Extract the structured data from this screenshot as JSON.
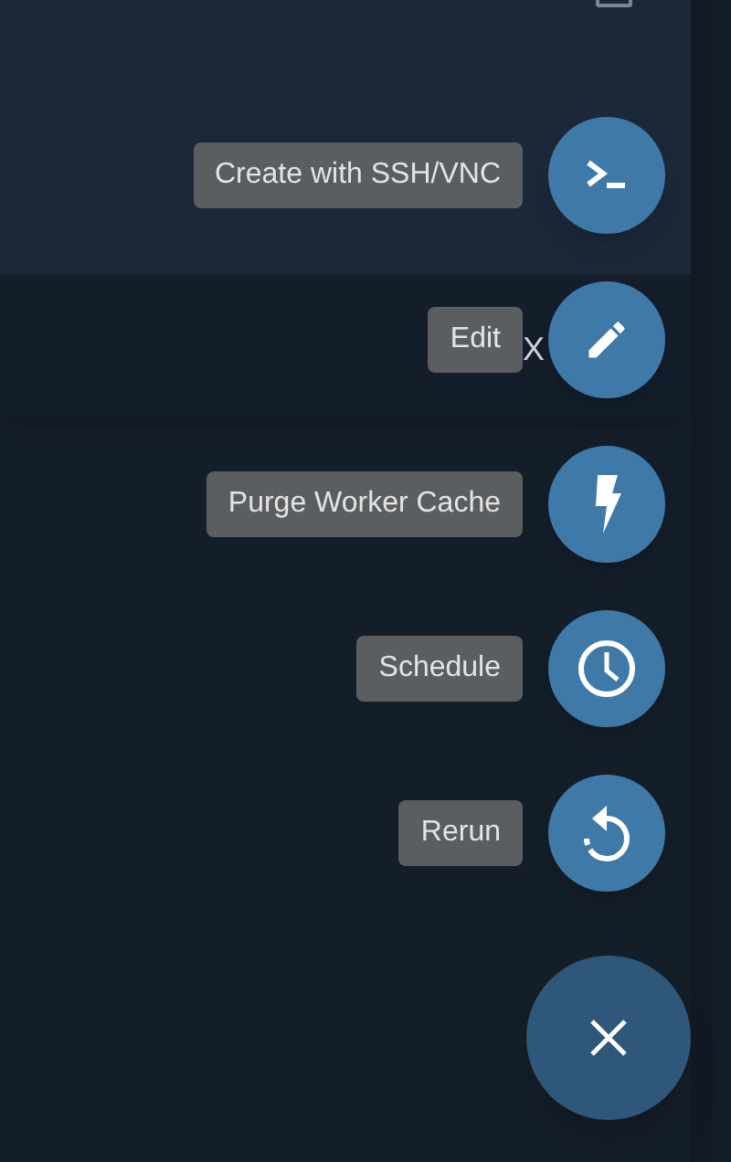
{
  "card": {
    "checkbox": {
      "checked": false
    },
    "row_text": "X"
  },
  "actions": [
    {
      "kind": "terminal",
      "tooltip": "Create with SSH/VNC"
    },
    {
      "kind": "edit",
      "tooltip": "Edit"
    },
    {
      "kind": "bolt",
      "tooltip": "Purge Worker Cache"
    },
    {
      "kind": "clock",
      "tooltip": "Schedule"
    },
    {
      "kind": "rerun",
      "tooltip": "Rerun"
    }
  ],
  "main_fab": {
    "expanded": true
  }
}
